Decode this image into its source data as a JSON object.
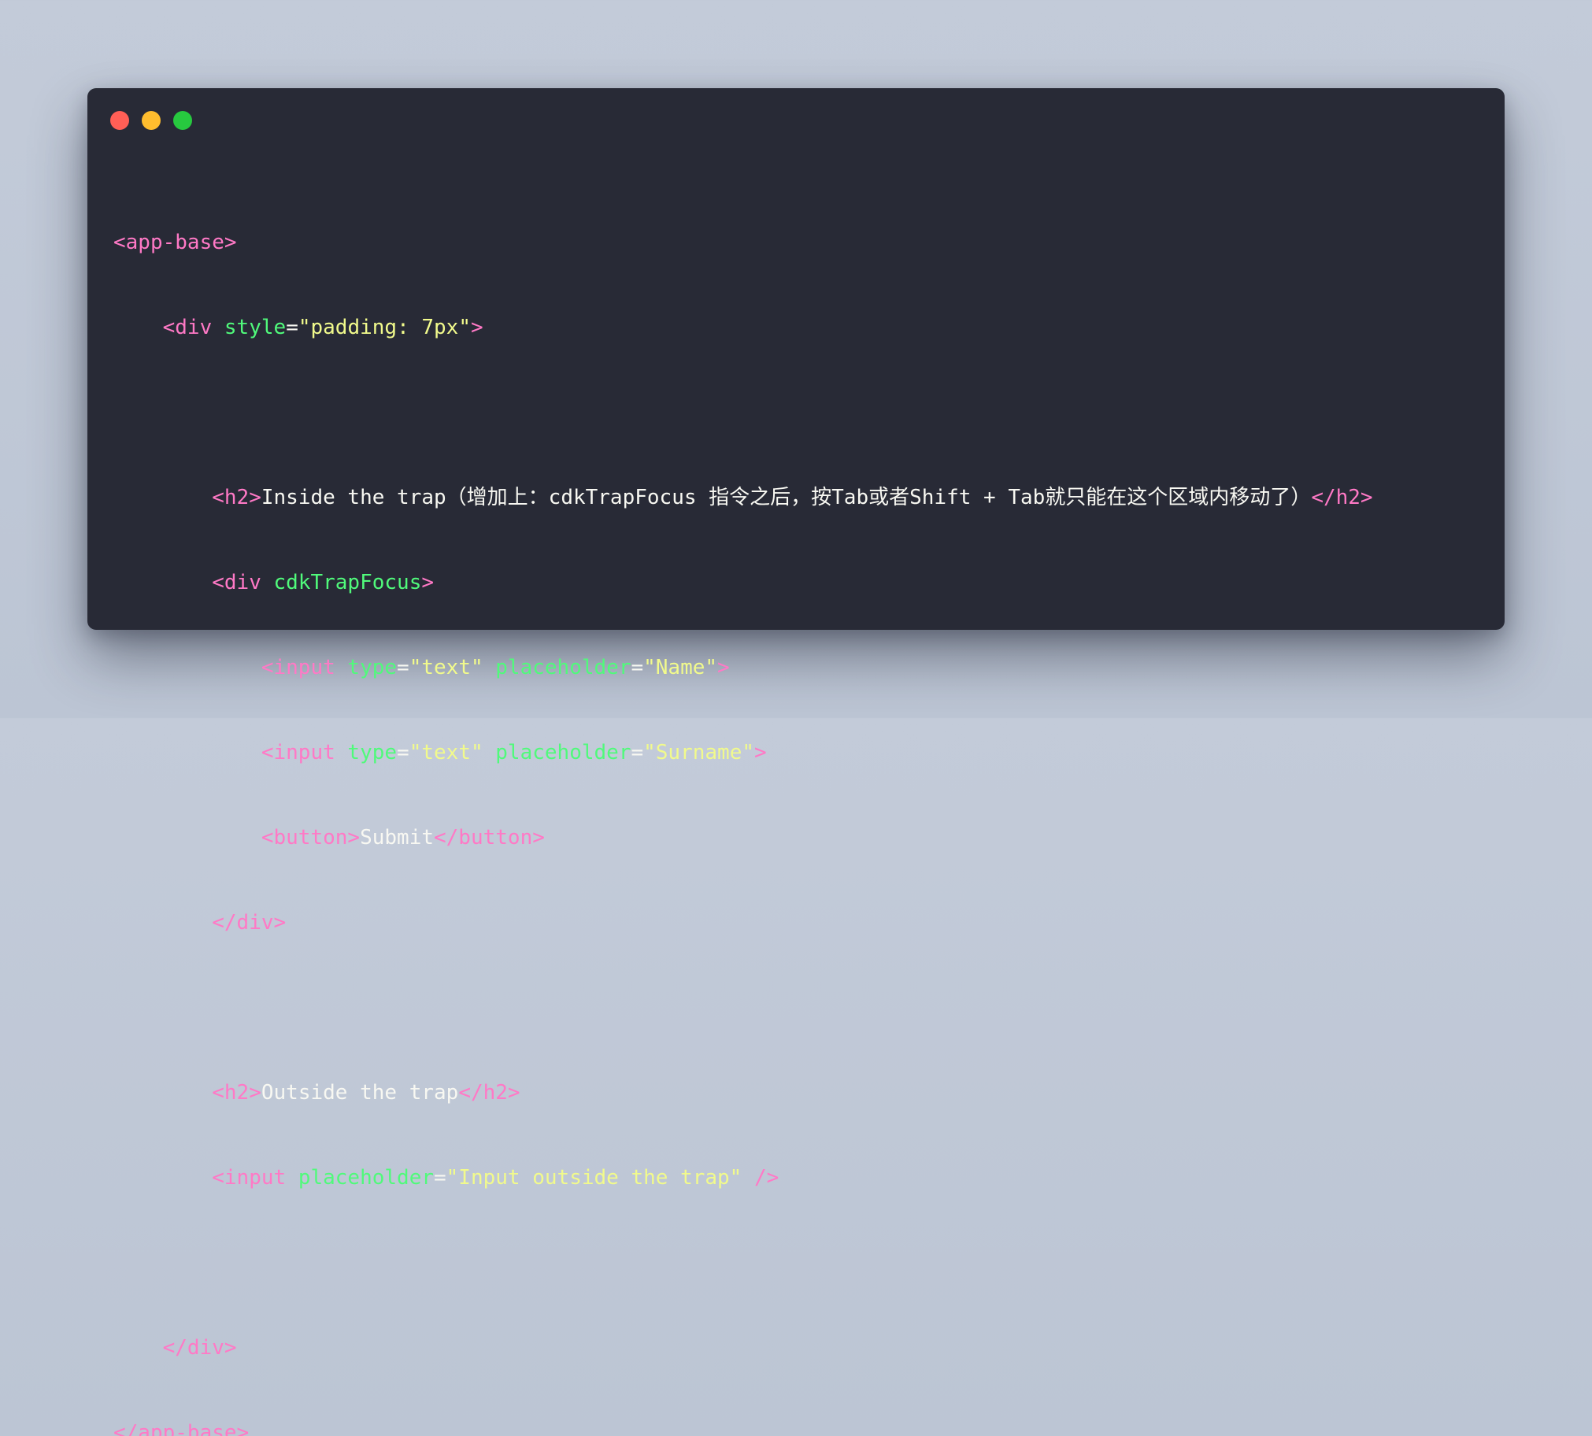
{
  "window": {
    "colors": {
      "background": "#282a36",
      "close": "#ff5f56",
      "minimize": "#ffbd2e",
      "maximize": "#27c93f",
      "tag": "#ff79c6",
      "attribute": "#50fa7b",
      "string": "#f1fa8c",
      "text": "#f8f8f2"
    }
  },
  "code": {
    "l1_tag_open": "<app-base>",
    "l2_indent": "    ",
    "l2_tag_open": "<div",
    "l2_attr": "style",
    "l2_eq": "=",
    "l2_value": "\"padding: 7px\"",
    "l2_close": ">",
    "l4_indent": "        ",
    "l4_tag_open": "<h2>",
    "l4_text": "Inside the trap（增加上：cdkTrapFocus 指令之后，按Tab或者Shift + Tab就只能在这个区域内移动了）",
    "l4_tag_close": "</h2>",
    "l5_indent": "        ",
    "l5_tag_open": "<div",
    "l5_attr": "cdkTrapFocus",
    "l5_close": ">",
    "l6_indent": "            ",
    "l6_tag_open": "<input",
    "l6_attr1": "type",
    "l6_eq1": "=",
    "l6_val1": "\"text\"",
    "l6_attr2": "placeholder",
    "l6_eq2": "=",
    "l6_val2": "\"Name\"",
    "l6_close": ">",
    "l7_indent": "            ",
    "l7_tag_open": "<input",
    "l7_attr1": "type",
    "l7_eq1": "=",
    "l7_val1": "\"text\"",
    "l7_attr2": "placeholder",
    "l7_eq2": "=",
    "l7_val2": "\"Surname\"",
    "l7_close": ">",
    "l8_indent": "            ",
    "l8_tag_open": "<button>",
    "l8_text": "Submit",
    "l8_tag_close": "</button>",
    "l9_indent": "        ",
    "l9_tag_close": "</div>",
    "l11_indent": "        ",
    "l11_tag_open": "<h2>",
    "l11_text": "Outside the trap",
    "l11_tag_close": "</h2>",
    "l12_indent": "        ",
    "l12_tag_open": "<input",
    "l12_attr": "placeholder",
    "l12_eq": "=",
    "l12_val": "\"Input outside the trap\"",
    "l12_close": "/>",
    "l14_indent": "    ",
    "l14_tag_close": "</div>",
    "l15_tag_close": "</app-base>"
  }
}
